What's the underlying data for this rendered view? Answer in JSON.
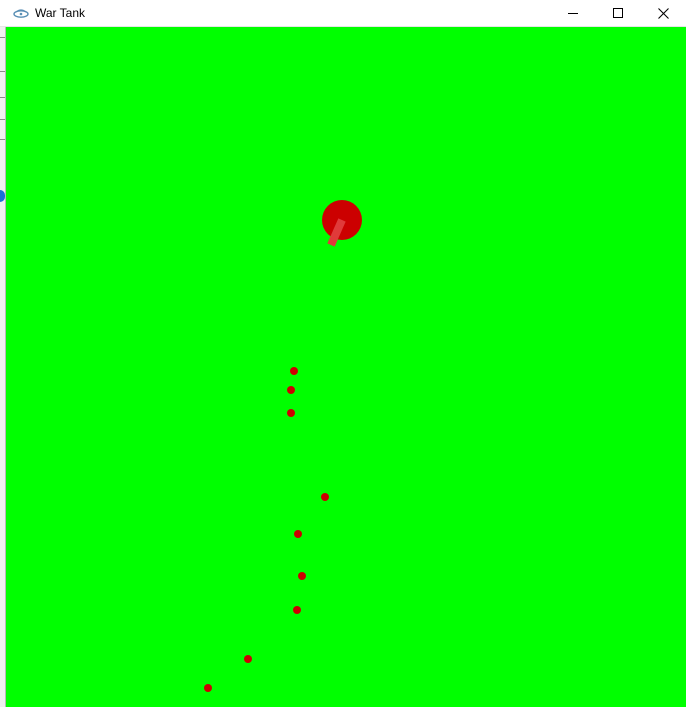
{
  "window": {
    "title": "War Tank",
    "controls": {
      "minimize_icon": "minimize-icon",
      "maximize_icon": "maximize-icon",
      "close_icon": "close-icon"
    }
  },
  "game": {
    "background_color": "#00ff00",
    "tank": {
      "body_color": "#cc0000",
      "barrel_color": "#e03a3a"
    },
    "bullet_color": "#cc0000"
  }
}
